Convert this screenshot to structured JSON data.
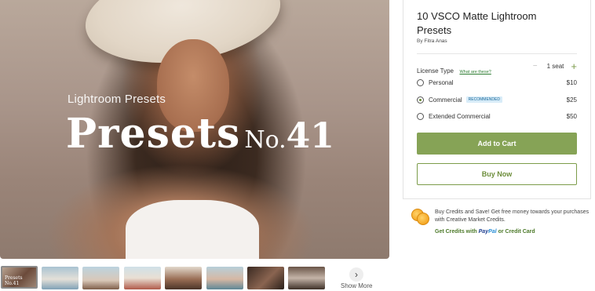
{
  "hero": {
    "subtitle": "Lightroom Presets",
    "title_word": "Presets",
    "title_no": "No.",
    "title_number": "41"
  },
  "thumbnails": {
    "items": [
      {
        "label": "Presets No.41",
        "active": true
      },
      {
        "label": ""
      },
      {
        "label": ""
      },
      {
        "label": ""
      },
      {
        "label": ""
      },
      {
        "label": ""
      },
      {
        "label": ""
      },
      {
        "label": ""
      }
    ],
    "next_icon": "›",
    "show_more": "Show More"
  },
  "product": {
    "title": "10 VSCO Matte Lightroom Presets",
    "by_prefix": "By",
    "author": "Fitra Anas",
    "license_label": "License Type",
    "what_link": "What are these?",
    "seat_minus_icon": "−",
    "seat_value": "1 seat",
    "seat_plus_icon": "+",
    "options": [
      {
        "label": "Personal",
        "price": "$10",
        "checked": false,
        "badge": ""
      },
      {
        "label": "Commercial",
        "price": "$25",
        "checked": true,
        "badge": "RECOMMENDED"
      },
      {
        "label": "Extended Commercial",
        "price": "$50",
        "checked": false,
        "badge": ""
      }
    ],
    "add_to_cart": "Add to Cart",
    "buy_now": "Buy Now"
  },
  "credits": {
    "text": "Buy Credits and Save! Get free money towards your purchases with Creative Market Credits.",
    "link_prefix": "Get Credits with",
    "paypal_pay": "Pay",
    "paypal_pal": "Pal",
    "link_suffix": "or Credit Card"
  },
  "colors": {
    "accent_green": "#86a356",
    "badge_bg": "#d8ecf8",
    "badge_text": "#1b6a9c",
    "coin": "#f4a623"
  }
}
